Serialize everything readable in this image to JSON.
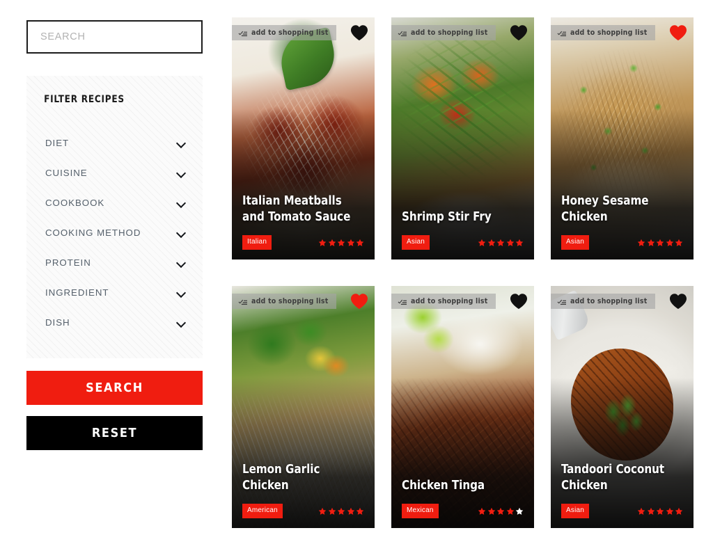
{
  "sidebar": {
    "search": {
      "placeholder": "SEARCH",
      "value": ""
    },
    "filter_title": "FILTER RECIPES",
    "filters": [
      {
        "label": "DIET"
      },
      {
        "label": "CUISINE"
      },
      {
        "label": "COOKBOOK"
      },
      {
        "label": "COOKING METHOD"
      },
      {
        "label": "PROTEIN"
      },
      {
        "label": "INGREDIENT"
      },
      {
        "label": "DISH"
      }
    ],
    "search_button": "SEARCH",
    "reset_button": "RESET"
  },
  "card_common": {
    "shopping_list_label": "add to shopping list",
    "shopping_list_icon": "checklist-icon",
    "favorite_icon": "heart-icon",
    "chevron_icon": "chevron-down-icon"
  },
  "colors": {
    "accent_red": "#f01d10",
    "star_filled": "#f01d10",
    "star_empty": "#ffffff",
    "heart_active": "#f01d10",
    "heart_inactive": "#111111",
    "button_reset": "#000000"
  },
  "recipes": [
    {
      "title": "Italian Meatballs and Tomato Sauce",
      "tag": "Italian",
      "rating": 5,
      "max_rating": 5,
      "favorited": false
    },
    {
      "title": "Shrimp Stir Fry",
      "tag": "Asian",
      "rating": 5,
      "max_rating": 5,
      "favorited": false
    },
    {
      "title": "Honey Sesame Chicken",
      "tag": "Asian",
      "rating": 5,
      "max_rating": 5,
      "favorited": true
    },
    {
      "title": "Lemon Garlic Chicken",
      "tag": "American",
      "rating": 5,
      "max_rating": 5,
      "favorited": true
    },
    {
      "title": "Chicken Tinga",
      "tag": "Mexican",
      "rating": 4,
      "max_rating": 5,
      "favorited": false
    },
    {
      "title": "Tandoori Coconut Chicken",
      "tag": "Asian",
      "rating": 5,
      "max_rating": 5,
      "favorited": false
    }
  ]
}
